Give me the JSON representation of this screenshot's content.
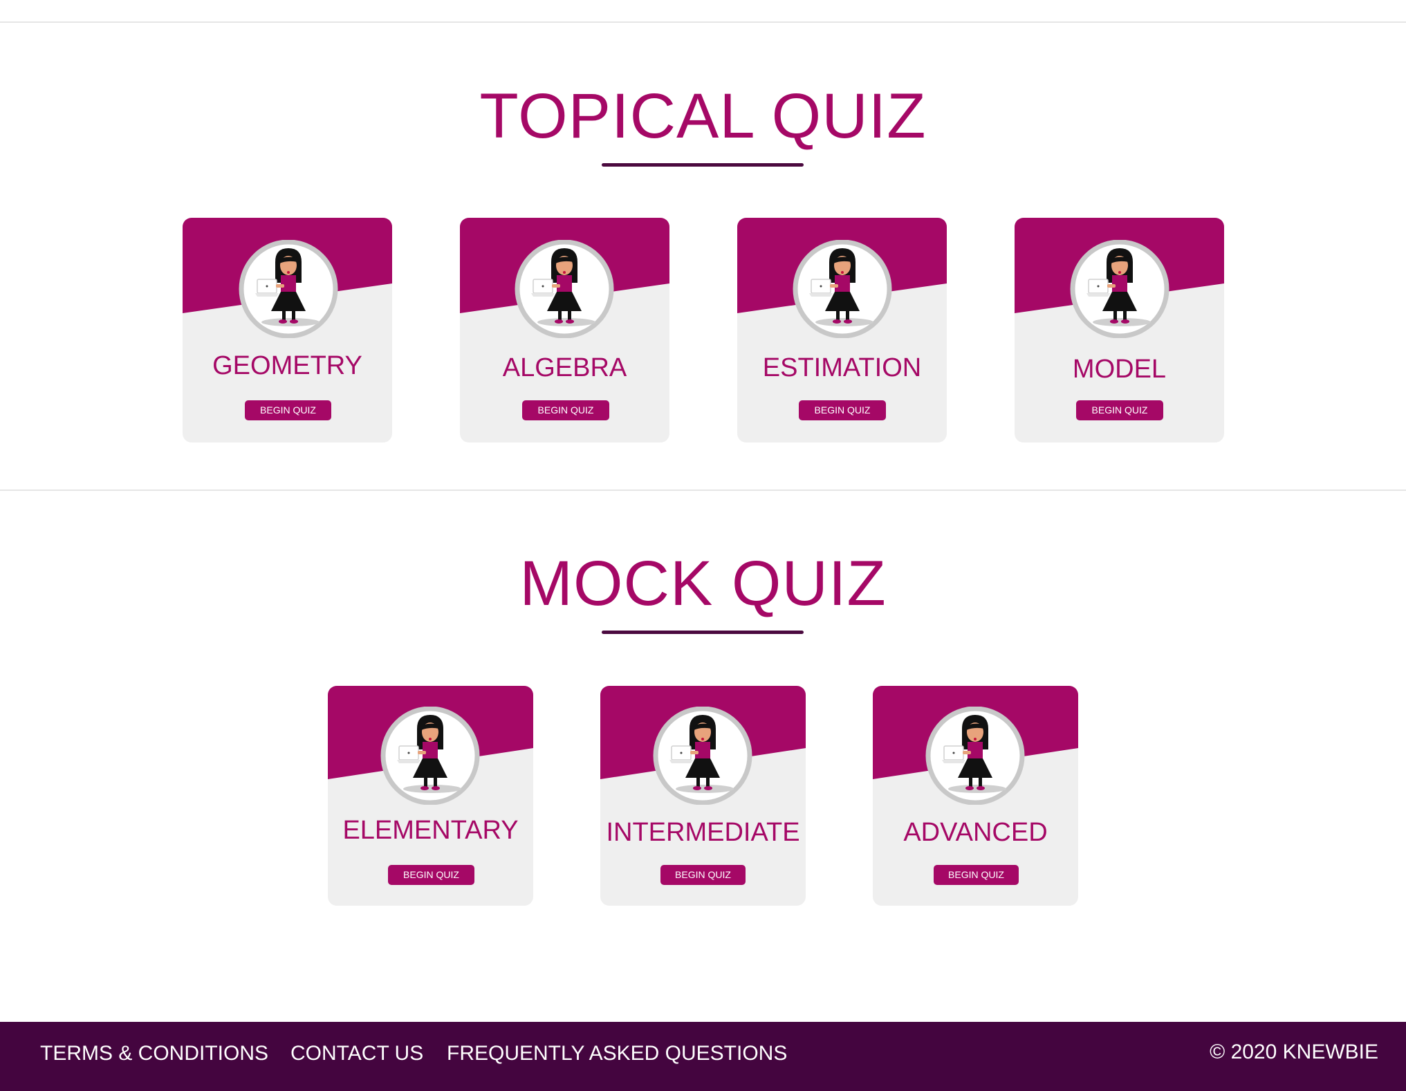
{
  "topical": {
    "title": "TOPICAL QUIZ",
    "cards": [
      {
        "name": "GEOMETRY",
        "button": "BEGIN QUIZ"
      },
      {
        "name": "ALGEBRA",
        "button": "BEGIN QUIZ"
      },
      {
        "name": "ESTIMATION",
        "button": "BEGIN QUIZ"
      },
      {
        "name": "MODEL",
        "button": "BEGIN QUIZ"
      }
    ]
  },
  "mock": {
    "title": "MOCK QUIZ",
    "cards": [
      {
        "name": "ELEMENTARY",
        "button": "BEGIN QUIZ"
      },
      {
        "name": "INTERMEDIATE",
        "button": "BEGIN QUIZ"
      },
      {
        "name": "ADVANCED",
        "button": "BEGIN QUIZ"
      }
    ]
  },
  "footer": {
    "links": [
      "TERMS & CONDITIONS",
      "CONTACT US",
      "FREQUENTLY ASKED QUESTIONS"
    ],
    "copyright": "© 2020 KNEWBIE"
  },
  "colors": {
    "accent": "#a50866",
    "dark": "#44053f",
    "card_bg": "#efefef"
  },
  "icons": {
    "card_illustration": "girl-with-laptop-icon"
  }
}
